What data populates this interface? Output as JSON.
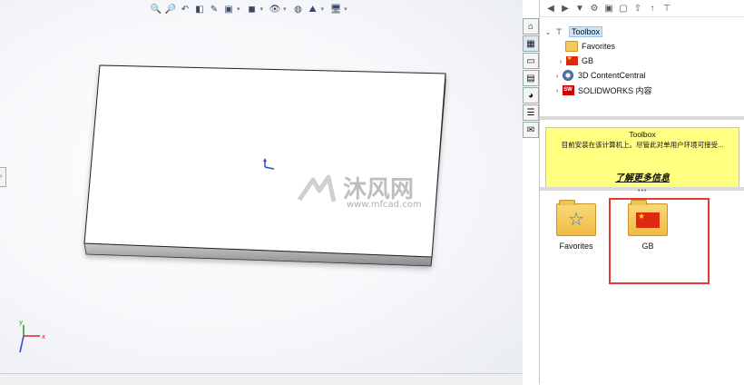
{
  "viewport": {
    "hud_icons": [
      "zoom-to-fit-icon",
      "zoom-area-icon",
      "previous-view-icon",
      "section-view-icon",
      "dynamic-annotation-icon",
      "view-orientation-icon",
      "display-style-icon",
      "hide-show-icon",
      "edit-appearance-icon",
      "apply-scene-icon",
      "view-settings-icon"
    ],
    "watermark_text": "沐风网",
    "watermark_url": "www.mfcad.com",
    "triad_axes": [
      "y",
      "x"
    ]
  },
  "task_pane_tabs": [
    "home-icon",
    "design-library-icon",
    "file-explorer-icon",
    "view-palette-icon",
    "appearances-icon",
    "custom-properties-icon",
    "forum-icon"
  ],
  "pane_toolbar": [
    "back-icon",
    "forward-icon",
    "add-to-library-icon",
    "toolbox-icon",
    "new-folder-icon",
    "settings-icon",
    "up-icon",
    "pin-icon"
  ],
  "tree": {
    "toolbox": "Toolbox",
    "favorites": "Favorites",
    "gb": "GB",
    "content_central": "3D ContentCentral",
    "solidworks_content": "SOLIDWORKS 内容"
  },
  "info_box": {
    "title": "Toolbox",
    "message": "目前安装在该计算机上。尽管此对单用户环境可接受...",
    "link": "了解更多信息"
  },
  "tiles": [
    {
      "label": "Favorites"
    },
    {
      "label": "GB"
    }
  ]
}
